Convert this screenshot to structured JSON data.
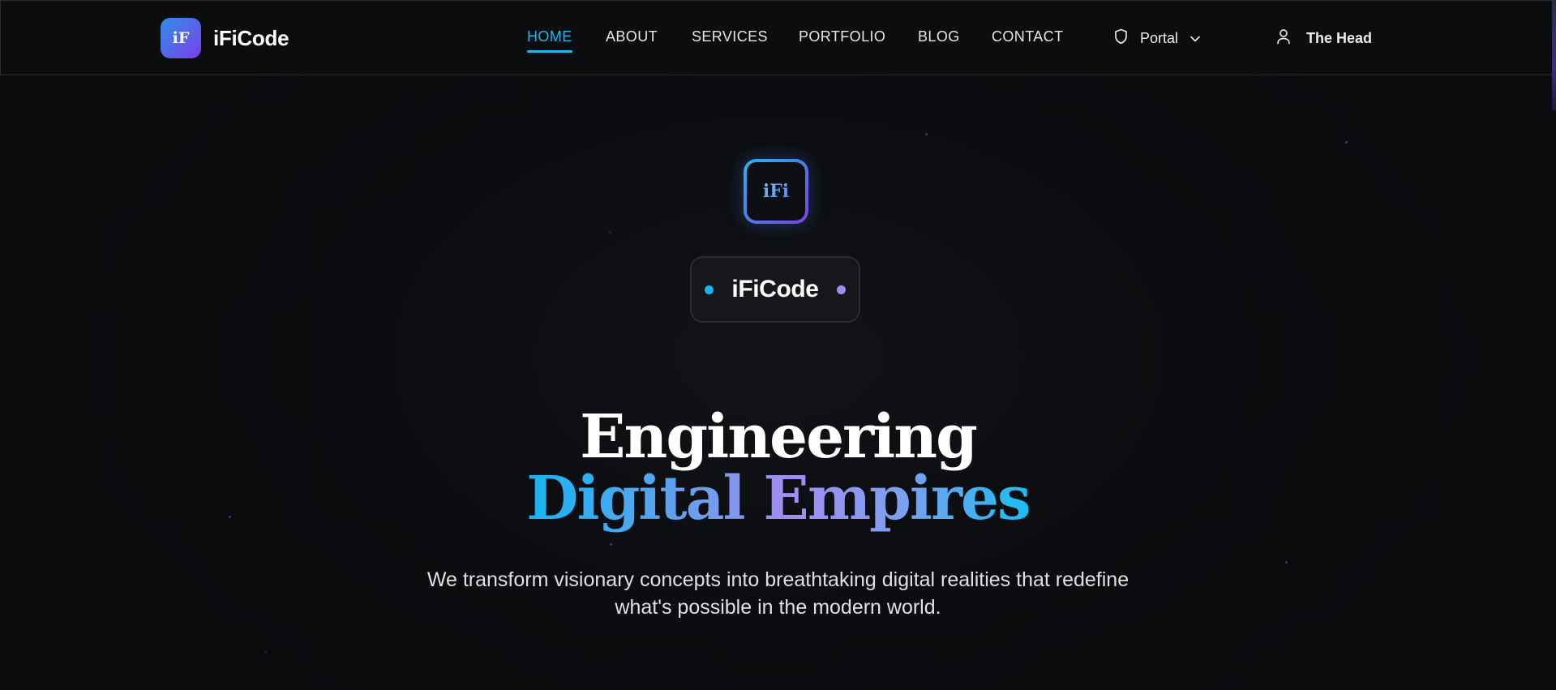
{
  "brand": {
    "logo_text": "iF",
    "name": "iFiCode"
  },
  "nav": {
    "items": [
      {
        "label": "HOME",
        "active": true
      },
      {
        "label": "ABOUT",
        "active": false
      },
      {
        "label": "SERVICES",
        "active": false
      },
      {
        "label": "PORTFOLIO",
        "active": false
      },
      {
        "label": "BLOG",
        "active": false
      },
      {
        "label": "CONTACT",
        "active": false
      }
    ],
    "portal": {
      "label": "Portal",
      "icon": "shield-icon",
      "dropdown_icon": "chevron-down-icon"
    },
    "user": {
      "label": "The Head",
      "icon": "user-icon"
    }
  },
  "hero": {
    "logo_text": "iFi",
    "pill_label": "iFiCode",
    "headline_line1": "Engineering",
    "headline_line2": "Digital Empires",
    "subtitle_line1": "We transform visionary concepts into breathtaking digital realities that redefine",
    "subtitle_line2": "what's possible in the modern world."
  },
  "colors": {
    "accent": "#22b7f0",
    "purple": "#7b3fe8",
    "background": "#0a0b0d"
  }
}
